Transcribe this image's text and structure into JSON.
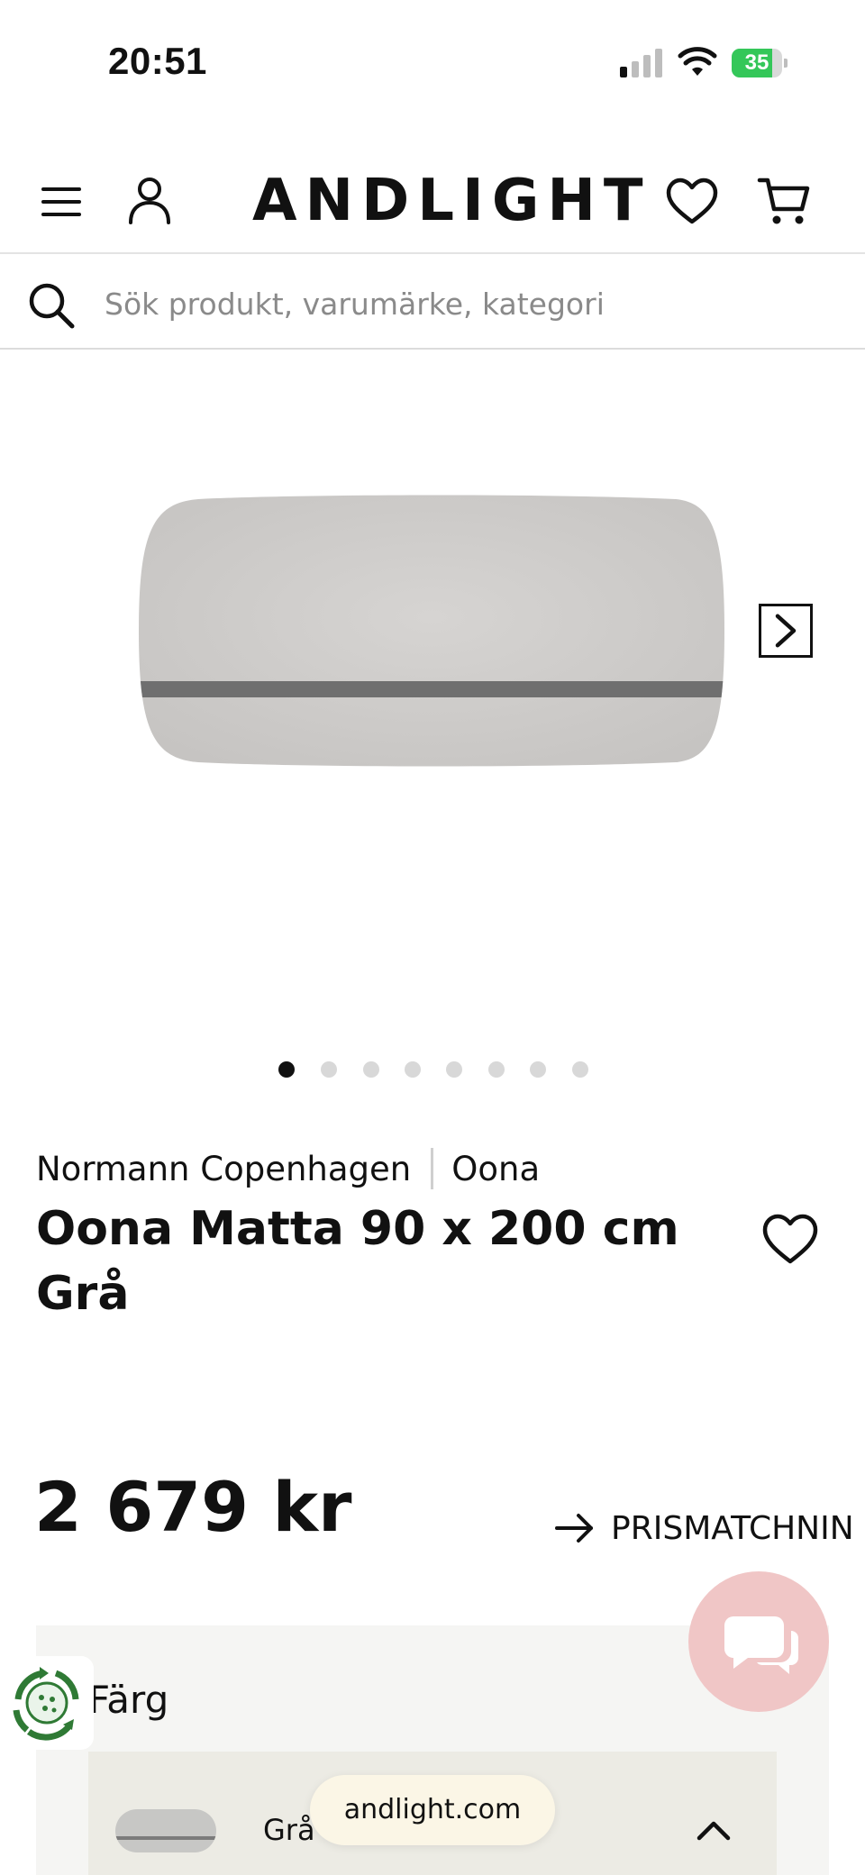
{
  "status_bar": {
    "time": "20:51",
    "battery_level": "35",
    "battery_charging": true,
    "signal_bars": 1
  },
  "header": {
    "logo": "ANDLIGHT",
    "icons": [
      "menu-icon",
      "account-icon",
      "heart-icon",
      "cart-icon"
    ]
  },
  "search": {
    "placeholder": "Sök produkt, varumärke, kategori"
  },
  "gallery": {
    "image_count": 8,
    "active_index": 0,
    "next_icon": "chevron-right-icon"
  },
  "product": {
    "brand": "Normann Copenhagen",
    "collection": "Oona",
    "title": "Oona Matta 90 x 200 cm Grå",
    "price": "2 679 kr",
    "price_match_label": "PRISMATCHNIN"
  },
  "color_section": {
    "label": "Färg",
    "selected_option": "Grå"
  },
  "browser": {
    "url": "andlight.com"
  },
  "colors": {
    "background": "#ffffff",
    "text": "#111111",
    "chat_button": "#f0c6c6",
    "color_panel": "#f5f5f3",
    "option_bg": "#ecebe4",
    "battery_green": "#34c759",
    "rug_grey": "#cfcdcb",
    "rug_stripe": "#6f6f6f"
  }
}
